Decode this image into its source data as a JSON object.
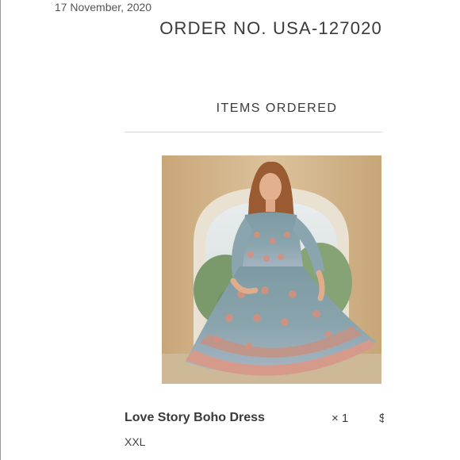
{
  "order": {
    "number": "ORDER NO. USA-127020",
    "date": "17 November, 2020"
  },
  "items_section": {
    "title": "ITEMS ORDERED"
  },
  "items": [
    {
      "name": "Love Story Boho Dress",
      "quantity": "× 1",
      "price_partial": "$",
      "size": "XXL",
      "image_alt": "Love Story Boho Dress"
    }
  ]
}
